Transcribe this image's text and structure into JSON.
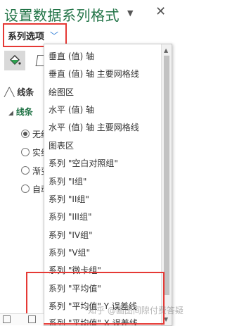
{
  "pane": {
    "title": "设置数据系列格式",
    "series_options_label": "系列选项"
  },
  "left_panel": {
    "line_header": "线条",
    "line_section": "线条",
    "options": [
      "无线",
      "实线",
      "渐变",
      "自动"
    ]
  },
  "dropdown": {
    "items": [
      "垂直 (值) 轴",
      "垂直 (值) 轴 主要网格线",
      "绘图区",
      "水平 (值) 轴",
      "水平 (值) 轴 主要网格线",
      "图表区",
      "系列 \"空白对照组\"",
      "系列 \"I组\"",
      "系列 \"II组\"",
      "系列 \"III组\"",
      "系列 \"IV组\"",
      "系列 \"V组\"",
      "系列 \"微卡组\"",
      "系列 \"平均值\"",
      "系列 \"平均值\" Y 误差线",
      "系列 \"平均值\" X 误差线"
    ]
  },
  "watermark": "知乎 @画图间隙付费答疑",
  "colors": {
    "title_green": "#217346",
    "highlight_red": "#e53935",
    "chevron_blue": "#2b7bd6"
  }
}
